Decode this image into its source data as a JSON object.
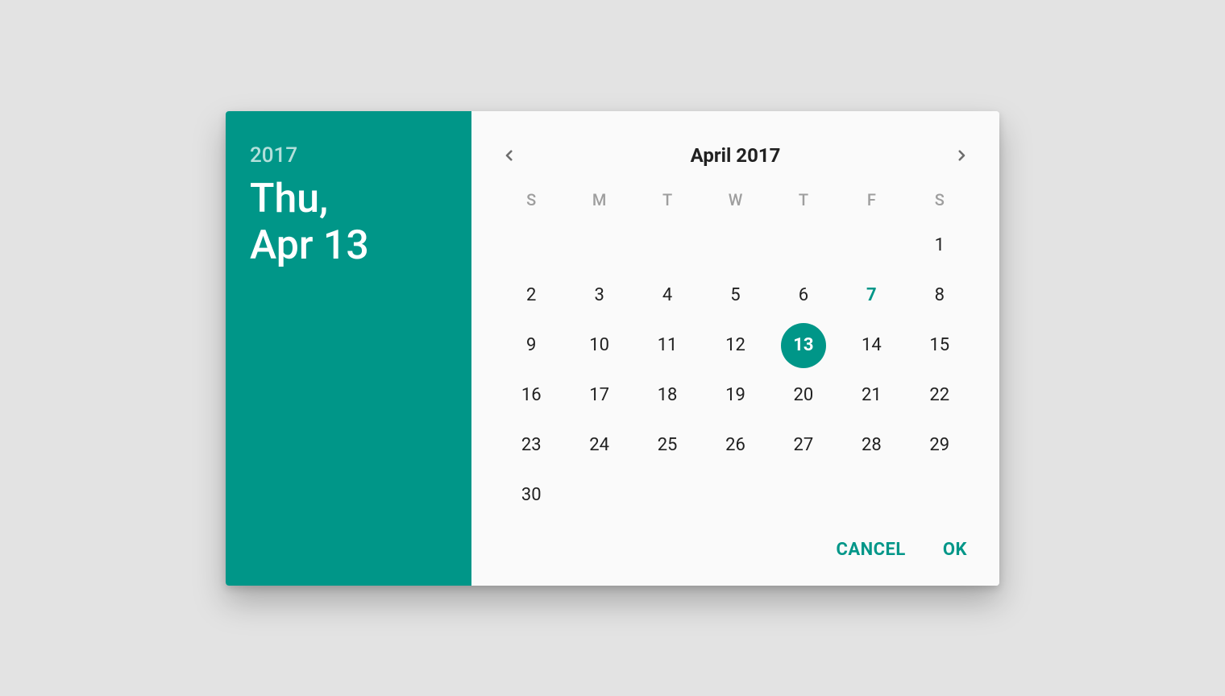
{
  "colors": {
    "accent": "#009688",
    "background": "#e3e3e3",
    "panel": "#fafafa"
  },
  "header": {
    "year": "2017",
    "date_line1": "Thu,",
    "date_line2": "Apr 13"
  },
  "calendar": {
    "month_title": "April 2017",
    "dow": [
      "S",
      "M",
      "T",
      "W",
      "T",
      "F",
      "S"
    ],
    "leading_blanks": 6,
    "days_in_month": 30,
    "today": 7,
    "selected": 13
  },
  "actions": {
    "cancel": "CANCEL",
    "ok": "OK"
  }
}
